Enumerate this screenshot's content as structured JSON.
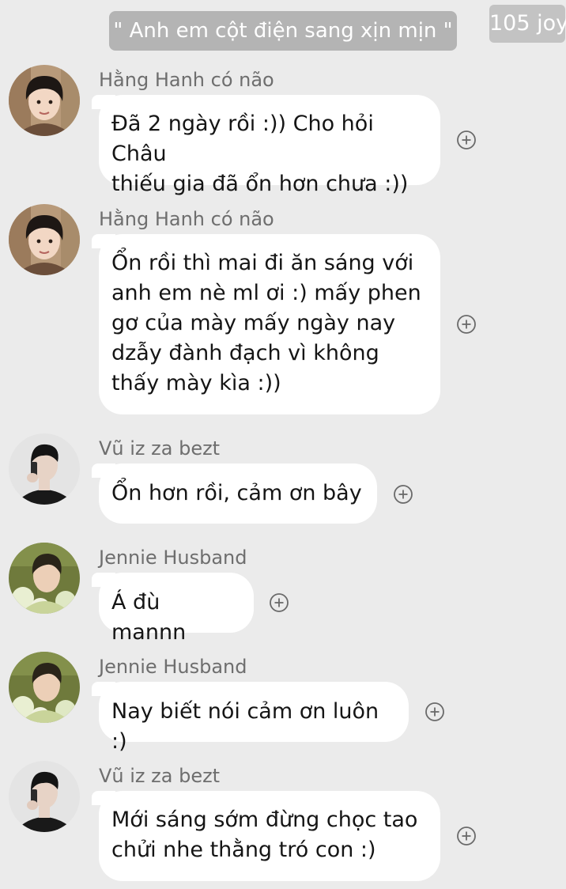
{
  "header": {
    "group_name": "\" Anh em cột điện sang xịn mịn \"",
    "count_badge": "105 joy"
  },
  "messages": [
    {
      "sender": "Hằng Hanh có não",
      "text": "Đã 2 ngày rồi :)) Cho hỏi Châu\nthiếu gia đã ổn hơn chưa :))",
      "avatar": "avatar-boy-curly-hair",
      "action": "add-reaction-icon"
    },
    {
      "sender": "Hằng Hanh có não",
      "text": "Ổn rồi thì mai đi ăn sáng với\nanh em nè ml ơi :) mấy phen\ngơ của mày mấy ngày nay\ndzẫy đành đạch vì không\nthấy mày kìa :))",
      "avatar": "avatar-boy-curly-hair",
      "action": "add-reaction-icon"
    },
    {
      "sender": "Vũ iz za bezt",
      "text": "Ổn hơn rồi, cảm ơn bây",
      "avatar": "avatar-man-on-phone",
      "action": "add-reaction-icon"
    },
    {
      "sender": "Jennie Husband",
      "text": "Á đù mannn",
      "avatar": "avatar-man-with-flowers",
      "action": "add-reaction-icon"
    },
    {
      "sender": "Jennie Husband",
      "text": "Nay biết nói cảm ơn luôn :)",
      "avatar": "avatar-man-with-flowers",
      "action": "add-reaction-icon"
    },
    {
      "sender": "Vũ iz za bezt",
      "text": "Mới sáng sớm đừng chọc tao\nchửi nhe thằng tró con :)",
      "avatar": "avatar-man-on-phone",
      "action": "add-reaction-icon"
    }
  ],
  "colors": {
    "background": "#ebebeb",
    "bubble": "#ffffff",
    "header_pill": "#b4b4b4",
    "sender_name": "#6e6e6e"
  }
}
